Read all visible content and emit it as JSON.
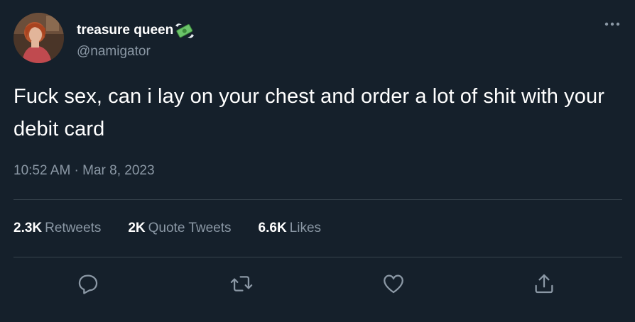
{
  "author": {
    "display_name": "treasure queen",
    "handle": "@namigator",
    "badge_icon": "money-with-wings-icon",
    "avatar": "profile-photo"
  },
  "tweet": {
    "text": "Fuck sex, can i lay on your chest and order a lot of shit with your debit card",
    "timestamp": "10:52 AM · Mar 8, 2023"
  },
  "stats": {
    "retweets_count": "2.3K",
    "retweets_label": "Retweets",
    "quotes_count": "2K",
    "quotes_label": "Quote Tweets",
    "likes_count": "6.6K",
    "likes_label": "Likes"
  },
  "actions": [
    "reply-icon",
    "retweet-icon",
    "like-icon",
    "share-icon"
  ],
  "colors": {
    "background": "#15202b",
    "primary_text": "#ffffff",
    "secondary_text": "#8b98a5",
    "divider": "#38444d"
  }
}
